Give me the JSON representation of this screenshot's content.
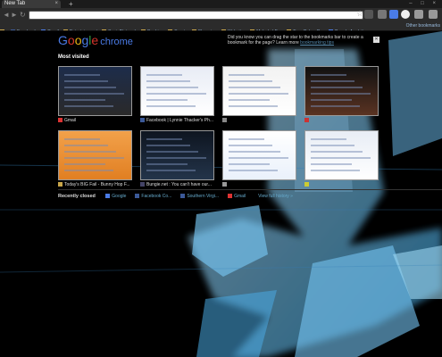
{
  "tab": {
    "title": "New Tab",
    "close": "×",
    "new": "+"
  },
  "window_controls": "– □ ×",
  "toolbar": {
    "back": "◄",
    "forward": "►",
    "reload": "↻",
    "url_value": "",
    "url_placeholder": "",
    "star": "☆"
  },
  "bookmarks": [
    {
      "label": "",
      "icon": "folder"
    },
    {
      "label": "Facebook",
      "icon": "facebook"
    },
    {
      "label": "Gmail",
      "icon": "gmail"
    },
    {
      "label": "Entertainment",
      "icon": "folder"
    },
    {
      "label": "SocialNetwork",
      "icon": "folder"
    },
    {
      "label": "Banking",
      "icon": "folder"
    },
    {
      "label": "Sports",
      "icon": "folder"
    },
    {
      "label": "Shopping",
      "icon": "folder"
    },
    {
      "label": "Websites",
      "icon": "folder"
    },
    {
      "label": "Mahalo | Fun",
      "icon": "mahalo"
    },
    {
      "label": "Free Poker O...",
      "icon": "folder"
    },
    {
      "label": "Google Analyti...",
      "icon": "google"
    }
  ],
  "other_bookmarks": "Other bookmarks",
  "logo": {
    "g1": "G",
    "o1": "o",
    "o2": "o",
    "g2": "g",
    "l": "l",
    "e": "e",
    "chrome": "chrome"
  },
  "tip": {
    "text": "Did you know you can drag the star to the bookmarks bar to create a bookmark for the page? Learn more ",
    "link": "bookmarking tips"
  },
  "most_visited_title": "Most visited",
  "thumbnails": [
    {
      "caption": "Gmail",
      "fav": "#d33"
    },
    {
      "caption": "Facebook | Lynnie Thacker's Ph...",
      "fav": "#3b5998"
    },
    {
      "caption": "",
      "fav": "#888"
    },
    {
      "caption": "",
      "fav": "#c33"
    },
    {
      "caption": "Today's BIG Fail - Bunny Hop F...",
      "fav": "#c9a64a"
    },
    {
      "caption": "Bungie.net : You can't have our...",
      "fav": "#446"
    },
    {
      "caption": "",
      "fav": "#999"
    },
    {
      "caption": "",
      "fav": "#cc3"
    }
  ],
  "recently_closed": {
    "label": "Recently closed",
    "items": [
      {
        "label": "Google",
        "fav": "#4a7be6"
      },
      {
        "label": "Facebook Co...",
        "fav": "#3b5998"
      },
      {
        "label": "Southern Virgi...",
        "fav": "#3b5998"
      },
      {
        "label": "Gmail",
        "fav": "#d33"
      }
    ],
    "history": "View full history »"
  },
  "colors": {
    "glow": "#6fd0ff",
    "accent": "#4a7be6"
  }
}
